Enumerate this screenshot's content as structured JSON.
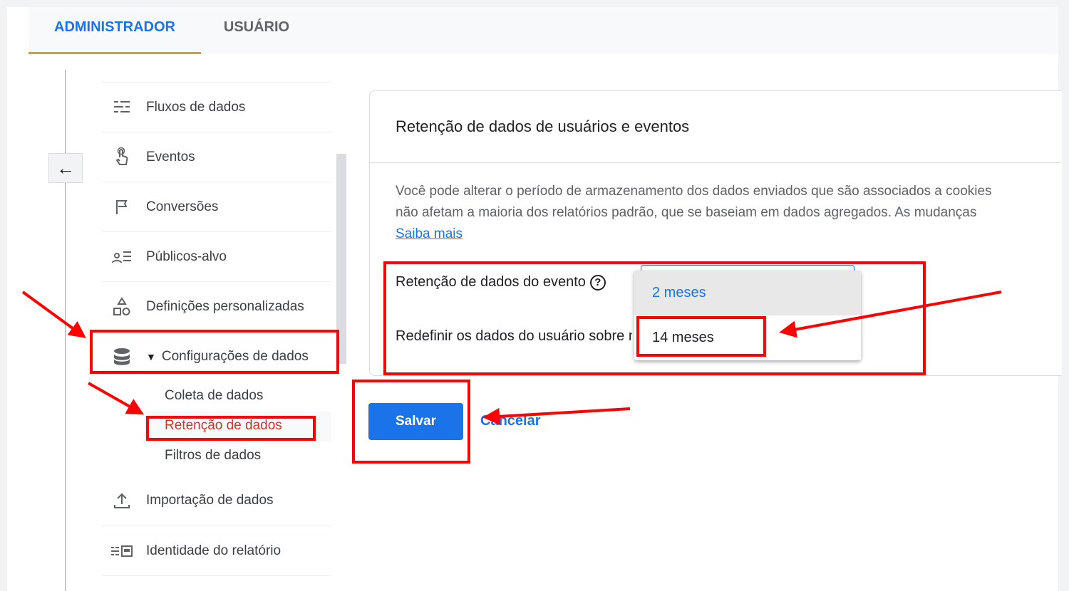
{
  "tabs": {
    "admin": "ADMINISTRADOR",
    "user": "USUÁRIO"
  },
  "nav": {
    "items": [
      {
        "label": "Fluxos de dados",
        "icon": "data-streams-icon"
      },
      {
        "label": "Eventos",
        "icon": "touch-icon"
      },
      {
        "label": "Conversões",
        "icon": "flag-icon"
      },
      {
        "label": "Públicos-alvo",
        "icon": "audience-icon"
      },
      {
        "label": "Definições personalizadas",
        "icon": "shapes-icon"
      },
      {
        "label": "Configurações de dados",
        "icon": "database-icon"
      }
    ],
    "sub_items": [
      "Coleta de dados",
      "Retenção de dados",
      "Filtros de dados"
    ],
    "items_after": [
      {
        "label": "Importação de dados",
        "icon": "upload-icon"
      },
      {
        "label": "Identidade do relatório",
        "icon": "report-identity-icon"
      }
    ]
  },
  "card": {
    "title": "Retenção de dados de usuários e eventos",
    "desc_line1": "Você pode alterar o período de armazenamento dos dados enviados que são associados a cookies",
    "desc_line2": "não afetam a maioria dos relatórios padrão, que se baseiam em dados agregados. As mudanças",
    "learn_more": "Saiba mais",
    "event_retention_label": "Retenção de dados do evento",
    "reset_label": "Redefinir os dados do usuário sobre nova atividade",
    "dropdown_options": [
      "2 meses",
      "14 meses"
    ]
  },
  "actions": {
    "save": "Salvar",
    "cancel": "Cancelar"
  },
  "colors": {
    "accent": "#1a73e8",
    "annotation": "#ff0000",
    "tab_underline": "#f29900"
  }
}
